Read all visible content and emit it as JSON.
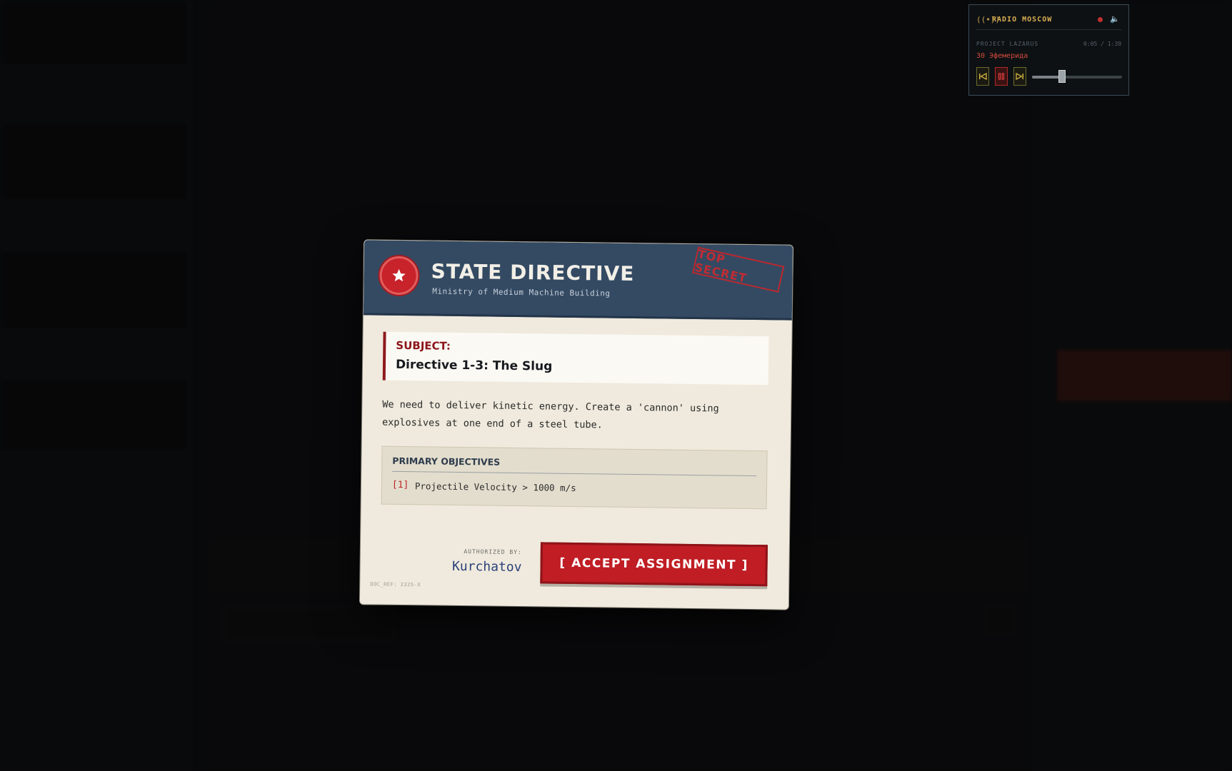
{
  "radio": {
    "title": "RADIO MOSCOW",
    "project": "PROJECT LAZARUS",
    "time": "0:05 / 1:39",
    "track": "30 Эфемерида",
    "volume_level": 0.33
  },
  "directive": {
    "title": "STATE DIRECTIVE",
    "subtitle": "Ministry of Medium Machine Building",
    "stamp": "TOP SECRET",
    "subject_label": "SUBJECT:",
    "subject_value": "Directive 1-3: The Slug",
    "body": "We need to deliver kinetic energy. Create a 'cannon' using explosives at one end of a steel tube.",
    "objectives_title": "PRIMARY OBJECTIVES",
    "objectives": [
      {
        "index": "[1]",
        "text": "Projectile Velocity > 1000 m/s"
      }
    ],
    "authorized_label": "AUTHORIZED BY:",
    "authorized_name": "Kurchatov",
    "doc_ref": "DOC_REF: 2325-X",
    "accept_label": "[ ACCEPT ASSIGNMENT ]"
  },
  "colors": {
    "header_blue": "#344a63",
    "accent_red": "#c01d24",
    "paper": "#efeadd"
  }
}
